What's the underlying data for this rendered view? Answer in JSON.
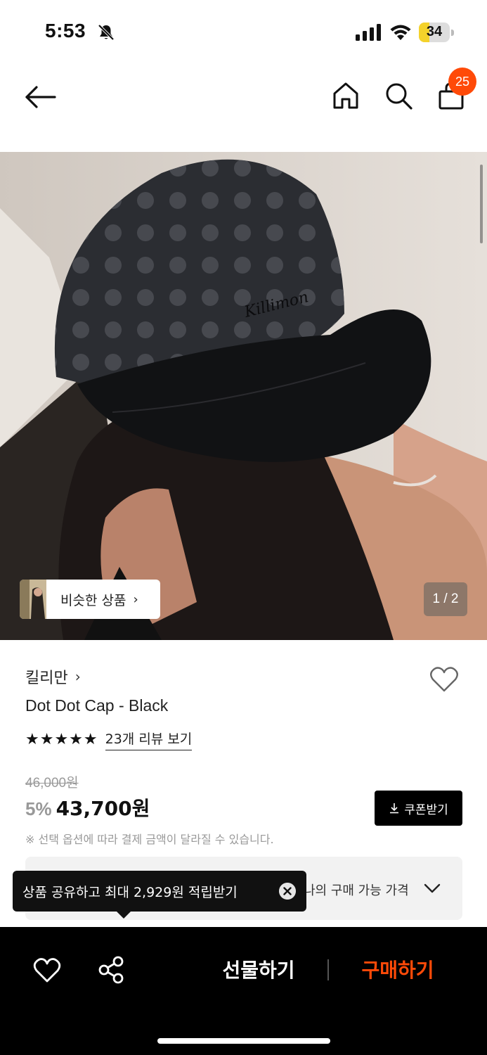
{
  "status_bar": {
    "time": "5:53",
    "battery": "34",
    "battery_level_percent": 34,
    "icons": [
      "bell-slash-icon",
      "cellular-signal-icon",
      "wifi-icon",
      "battery-icon"
    ]
  },
  "header": {
    "icons": [
      "arrow-left-icon",
      "home-icon",
      "search-icon",
      "shopping-bag-icon"
    ],
    "cart_count": "25",
    "accent_color": "#ff4a08"
  },
  "gallery": {
    "similar_label": "비슷한 상품",
    "similar_chevron": "›",
    "page_indicator": "1 / 2"
  },
  "product": {
    "brand": "킬리만",
    "brand_chevron": "›",
    "title": "Dot Dot Cap - Black",
    "rating_stars": "★★★★★",
    "rating": 5,
    "review_link": "23개 리뷰 보기",
    "original_price": "46,000원",
    "discount": "5%",
    "sale_price": "43,700원",
    "coupon_label": "쿠폰받기",
    "note": "※ 선택 옵션에 따라 결제 금액이 달라질 수 있습니다.",
    "price_panel_label": "나의 구매 가능 가격"
  },
  "tooltip": {
    "text": "상품 공유하고 최대 2,929원 적립받기"
  },
  "bottom_bar": {
    "gift_label": "선물하기",
    "buy_label": "구매하기",
    "buy_color": "#ff4a08",
    "icons": [
      "heart-outline-icon",
      "share-icon"
    ]
  }
}
